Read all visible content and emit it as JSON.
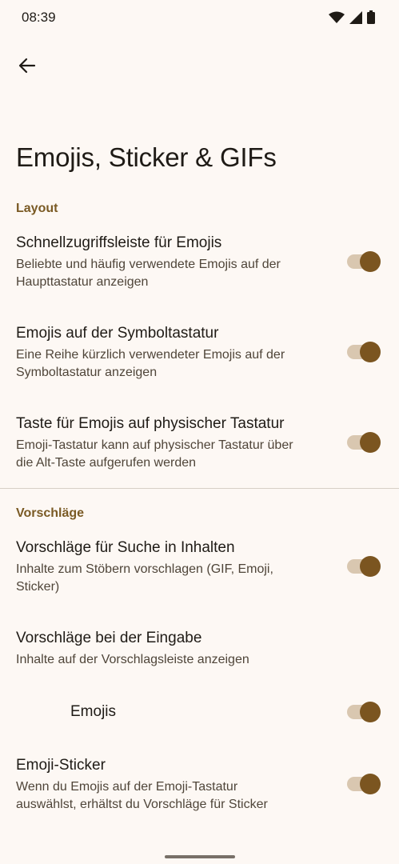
{
  "status_bar": {
    "time": "08:39"
  },
  "page": {
    "title": "Emojis, Sticker & GIFs"
  },
  "sections": {
    "layout": {
      "header": "Layout",
      "items": [
        {
          "title": "Schnellzugriffsleiste für Emojis",
          "description_line1": "Beliebte und häufig verwendete Emojis auf der",
          "description_line2": "Haupttastatur anzeigen",
          "enabled": true
        },
        {
          "title": "Emojis auf der Symboltastatur",
          "description_line1": "Eine Reihe kürzlich verwendeter Emojis auf der",
          "description_line2": "Symboltastatur anzeigen",
          "enabled": true
        },
        {
          "title": "Taste für Emojis auf physischer Tastatur",
          "description_line1": "Emoji-Tastatur kann auf physischer Tastatur über",
          "description_line2": "die Alt-Taste aufgerufen werden",
          "enabled": true
        }
      ]
    },
    "suggestions": {
      "header": "Vorschläge",
      "content_search": {
        "title": "Vorschläge für Suche in Inhalten",
        "description_line1": "Inhalte zum Stöbern vorschlagen (GIF, Emoji,",
        "description_line2": "Sticker)",
        "enabled": true
      },
      "typing": {
        "title": "Vorschläge bei der Eingabe",
        "description": "Inhalte auf der Vorschlagsleiste anzeigen"
      },
      "emojis": {
        "title": "Emojis",
        "enabled": true
      },
      "emoji_sticker": {
        "title": "Emoji-Sticker",
        "description_line1": "Wenn du Emojis auf der Emoji-Tastatur",
        "description_line2": "auswählst, erhältst du Vorschläge für Sticker",
        "enabled": true
      }
    }
  },
  "colors": {
    "background": "#fdf8f4",
    "accent": "#7b5520",
    "track": "#d9c7b0",
    "section_header": "#7a5a24"
  },
  "icons": {
    "back": "arrow-back-icon",
    "wifi": "wifi-icon",
    "signal": "signal-icon",
    "battery": "battery-icon"
  }
}
